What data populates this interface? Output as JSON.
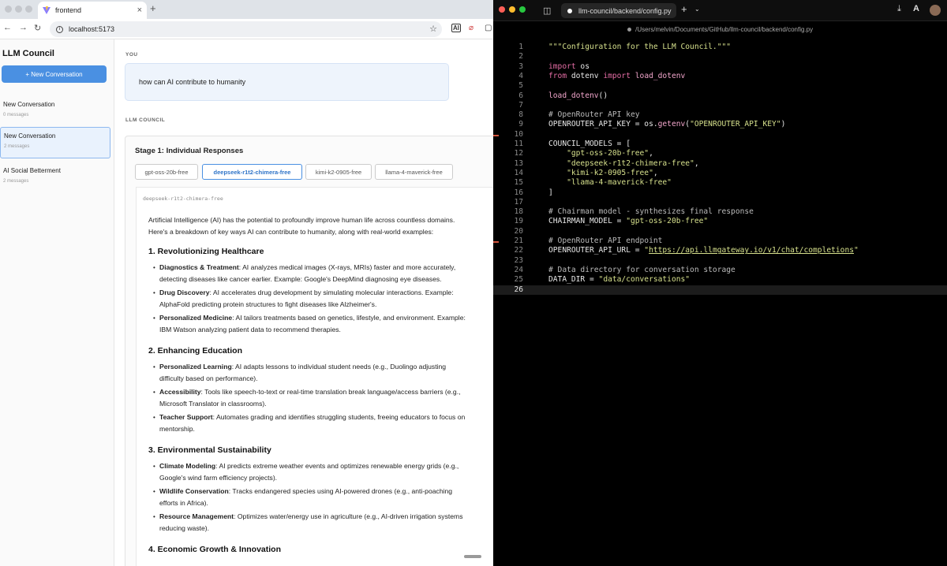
{
  "browser": {
    "tab_title": "frontend",
    "url": "localhost:5173",
    "ext_ai_label": "AI"
  },
  "app": {
    "title": "LLM Council",
    "new_conversation_label": "+ New Conversation",
    "conversations": [
      {
        "title": "New Conversation",
        "count": "0 messages",
        "active": false
      },
      {
        "title": "New Conversation",
        "count": "2 messages",
        "active": true
      },
      {
        "title": "AI Social Betterment",
        "count": "2 messages",
        "active": false
      }
    ],
    "you_label": "YOU",
    "user_message": "how can AI contribute to humanity",
    "council_label": "LLM COUNCIL",
    "stage_title": "Stage 1: Individual Responses",
    "model_tabs": [
      "gpt-oss-20b-free",
      "deepseek-r1t2-chimera-free",
      "kimi-k2-0905-free",
      "llama-4-maverick-free"
    ],
    "active_model_tab": 1,
    "response_model": "deepseek-r1t2-chimera-free",
    "response_intro_1": "Artificial Intelligence (AI) has the potential to profoundly improve human life across countless domains.",
    "response_intro_2": "Here's a breakdown of key ways AI can contribute to humanity, along with real-world examples:",
    "sections": [
      {
        "heading": "1. Revolutionizing Healthcare",
        "items": [
          {
            "bold": "Diagnostics & Treatment",
            "line1": ": AI analyzes medical images (X-rays, MRIs) faster and more accurately,",
            "line2": "detecting diseases like cancer earlier. Example: Google's DeepMind diagnosing eye diseases."
          },
          {
            "bold": "Drug Discovery",
            "line1": ": AI accelerates drug development by simulating molecular interactions. Example:",
            "line2": "AlphaFold predicting protein structures to fight diseases like Alzheimer's."
          },
          {
            "bold": "Personalized Medicine",
            "line1": ": AI tailors treatments based on genetics, lifestyle, and environment. Example:",
            "line2": "IBM Watson analyzing patient data to recommend therapies."
          }
        ]
      },
      {
        "heading": "2. Enhancing Education",
        "items": [
          {
            "bold": "Personalized Learning",
            "line1": ": AI adapts lessons to individual student needs (e.g., Duolingo adjusting",
            "line2": "difficulty based on performance)."
          },
          {
            "bold": "Accessibility",
            "line1": ": Tools like speech-to-text or real-time translation break language/access barriers (e.g.,",
            "line2": "Microsoft Translator in classrooms)."
          },
          {
            "bold": "Teacher Support",
            "line1": ": Automates grading and identifies struggling students, freeing educators to focus on",
            "line2": "mentorship."
          }
        ]
      },
      {
        "heading": "3. Environmental Sustainability",
        "items": [
          {
            "bold": "Climate Modeling",
            "line1": ": AI predicts extreme weather events and optimizes renewable energy grids (e.g.,",
            "line2": "Google's wind farm efficiency projects)."
          },
          {
            "bold": "Wildlife Conservation",
            "line1": ": Tracks endangered species using AI-powered drones (e.g., anti-poaching",
            "line2": "efforts in Africa)."
          },
          {
            "bold": "Resource Management",
            "line1": ": Optimizes water/energy use in agriculture (e.g., AI-driven irrigation systems",
            "line2": "reducing waste)."
          }
        ]
      },
      {
        "heading": "4. Economic Growth & Innovation",
        "items": []
      }
    ]
  },
  "editor": {
    "tab_title": "llm-council/backend/config.py",
    "path": "/Users/melvin/Documents/GitHub/llm-council/backend/config.py",
    "current_line": 26,
    "modified_lines": [
      11,
      22
    ],
    "lines": [
      "\"\"\"Configuration for the LLM Council.\"\"\"",
      "",
      "import os",
      "from dotenv import load_dotenv",
      "",
      "load_dotenv()",
      "",
      "# OpenRouter API key",
      "OPENROUTER_API_KEY = os.getenv(\"OPENROUTER_API_KEY\")",
      "",
      "COUNCIL_MODELS = [",
      "    \"gpt-oss-20b-free\",",
      "    \"deepseek-r1t2-chimera-free\",",
      "    \"kimi-k2-0905-free\",",
      "    \"llama-4-maverick-free\"",
      "]",
      "",
      "# Chairman model - synthesizes final response",
      "CHAIRMAN_MODEL = \"gpt-oss-20b-free\"",
      "",
      "# OpenRouter API endpoint",
      "OPENROUTER_API_URL = \"https://api.llmgateway.io/v1/chat/completions\"",
      "",
      "# Data directory for conversation storage",
      "DATA_DIR = \"data/conversations\"",
      ""
    ]
  },
  "colors": {
    "accent": "#4a90e2",
    "keyword": "#e56da5",
    "string": "#d6e08c",
    "editor_bg": "#000000"
  }
}
